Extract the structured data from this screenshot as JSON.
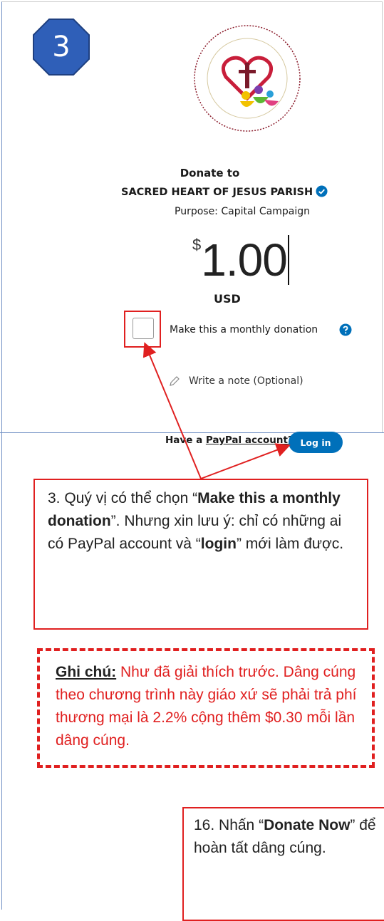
{
  "step": {
    "number": "3"
  },
  "donation": {
    "donate_to": "Donate to",
    "org_name": "SACRED HEART OF JESUS PARISH",
    "purpose": "Purpose: Capital Campaign",
    "currency_symbol": "$",
    "amount": "1.00",
    "currency_code": "USD",
    "monthly_label": "Make this a monthly donation",
    "note_placeholder": "Write a note (Optional)"
  },
  "paypal": {
    "question_prefix": "Have a ",
    "question_link": "PayPal account?",
    "login_label": "Log in"
  },
  "notes": {
    "step3": {
      "t1": "3. Quý vị có thể chọn “",
      "b1": "Make this a monthly donation",
      "t2": "”.  Nhưng xin lưu ý:  chỉ có những ai có PayPal account và “",
      "b2": "login",
      "t3": "” mới làm được."
    },
    "ghichu": {
      "label": "Ghi chú:",
      "text": " Như đã giải thích trước.  Dâng cúng theo chương trình này giáo xứ sẽ phải trả phí thương mại là 2.2% cộng thêm $0.30 mỗi lần dâng cúng."
    },
    "step16": {
      "t1": "16. Nhấn “",
      "b1": "Donate Now",
      "t2": "” để hoàn tất dâng cúng."
    }
  },
  "colors": {
    "accent_red": "#e02020",
    "paypal_blue": "#0070ba",
    "badge_blue": "#2f5fb8"
  }
}
